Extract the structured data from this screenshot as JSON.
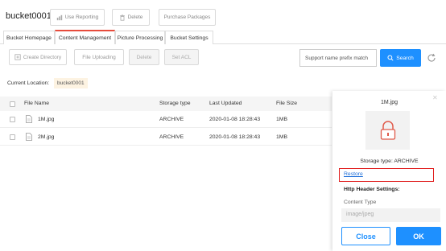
{
  "header": {
    "bucket_name": "bucket0001",
    "buttons": [
      {
        "label": "Use Reporting",
        "icon": "chart-icon"
      },
      {
        "label": "Delete",
        "icon": "trash-icon"
      },
      {
        "label": "Purchase Packages",
        "icon": ""
      }
    ]
  },
  "tabs": [
    {
      "label": "Bucket Homepage"
    },
    {
      "label": "Content Management",
      "active": true
    },
    {
      "label": "Picture Processing"
    },
    {
      "label": "Bucket Settings"
    }
  ],
  "toolbar": {
    "create_directory": "Create Directory",
    "file_uploading": "File Uploading",
    "delete": "Delete",
    "set_acl": "Set ACL",
    "search_placeholder": "Support name prefix match",
    "search_button": "Search"
  },
  "location": {
    "label": "Current Location:",
    "value": "bucket0001"
  },
  "table": {
    "columns": [
      "File Name",
      "Storage type",
      "Last Updated",
      "File Size"
    ],
    "rows": [
      {
        "name": "1M.jpg",
        "storage": "ARCHIVE",
        "updated": "2020-01-08 18:28:43",
        "size": "1MB"
      },
      {
        "name": "2M.jpg",
        "storage": "ARCHIVE",
        "updated": "2020-01-08 18:28:43",
        "size": "1MB"
      }
    ]
  },
  "panel": {
    "title": "1M.jpg",
    "storage_text": "Storage type: ARCHIVE",
    "restore": "Restore",
    "http_header": "Http Header Settings:",
    "content_type_label": "Content Type",
    "content_type_value": "image/jpeg",
    "close_button": "Close",
    "ok_button": "OK",
    "highlight_color": "#e01b1b",
    "accent_color": "#1e90ff"
  }
}
